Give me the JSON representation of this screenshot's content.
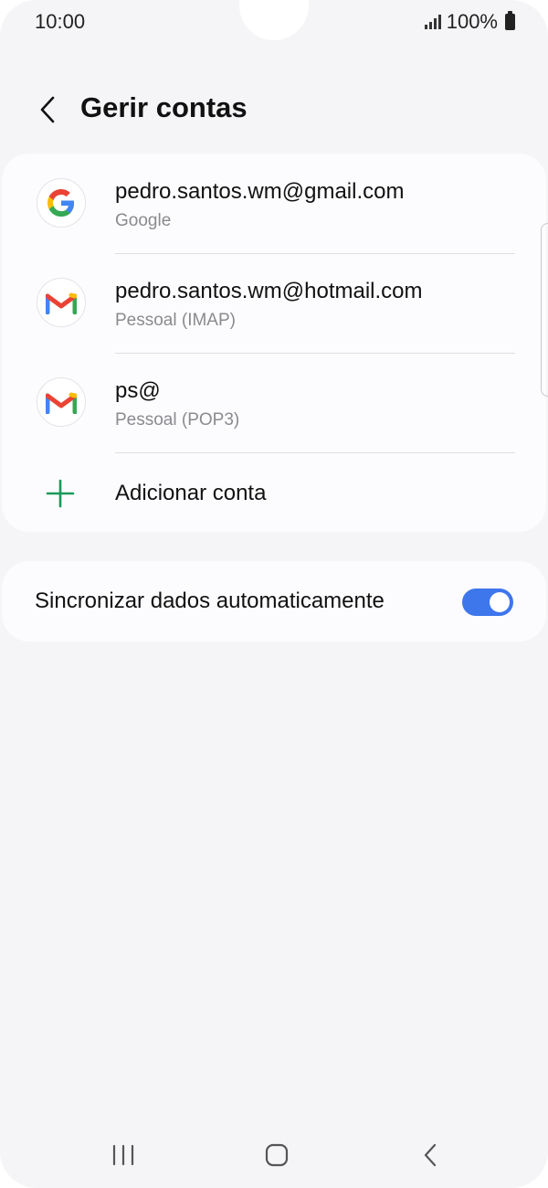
{
  "status_bar": {
    "time": "10:00",
    "battery": "100%"
  },
  "header": {
    "title": "Gerir contas",
    "back_icon": "chevron-left-icon"
  },
  "accounts": [
    {
      "title": "pedro.santos.wm@gmail.com",
      "subtitle": "Google",
      "icon": "google-icon"
    },
    {
      "title": "pedro.santos.wm@hotmail.com",
      "subtitle": "Pessoal (IMAP)",
      "icon": "gmail-icon"
    },
    {
      "title": "ps@",
      "subtitle": "Pessoal (POP3)",
      "icon": "gmail-icon"
    }
  ],
  "add_account": {
    "label": "Adicionar conta",
    "icon": "plus-icon"
  },
  "sync": {
    "label": "Sincronizar dados automaticamente",
    "enabled": true
  },
  "colors": {
    "accent": "#3e76ec",
    "add_icon": "#1a9a5a",
    "background": "#f5f5f7",
    "card": "#fcfcfe"
  },
  "nav_bar": {
    "recents_icon": "recent-apps-icon",
    "home_icon": "home-icon",
    "back_icon": "back-icon"
  }
}
